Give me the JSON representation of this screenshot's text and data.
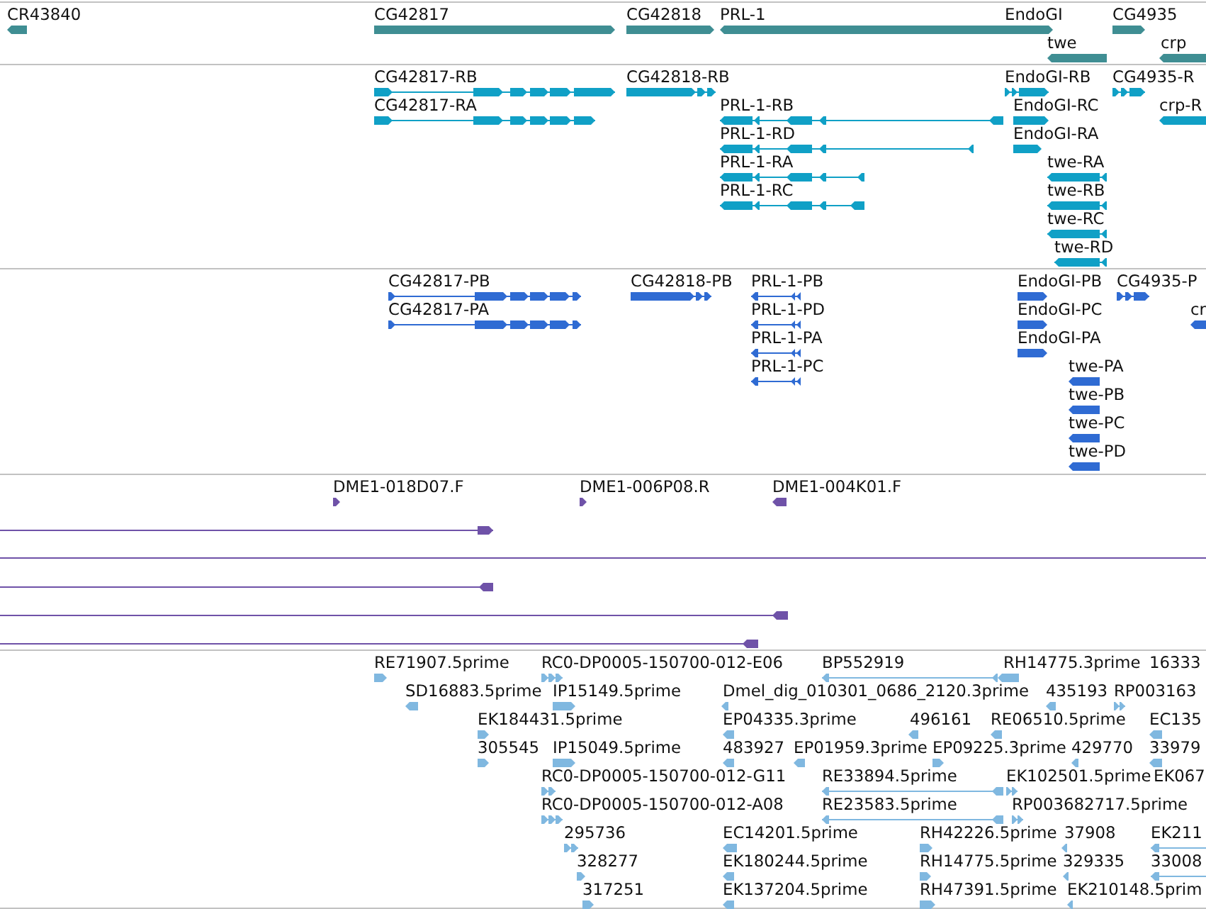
{
  "tracks": [
    {
      "kind": "gene",
      "features": [
        {
          "label": "CR43840",
          "forward": false
        },
        {
          "label": "CG42817",
          "forward": true
        },
        {
          "label": "CG42818",
          "forward": true
        },
        {
          "label": "PRL-1",
          "forward": false
        },
        {
          "label": "EndoGI",
          "forward": true
        },
        {
          "label": "twe",
          "forward": false
        },
        {
          "label": "CG4935",
          "forward": true
        },
        {
          "label": "crp",
          "forward": false
        }
      ]
    },
    {
      "kind": "transcript",
      "features": [
        {
          "label": "CG42817-RB",
          "forward": true
        },
        {
          "label": "CG42817-RA",
          "forward": true
        },
        {
          "label": "CG42818-RB",
          "forward": true
        },
        {
          "label": "PRL-1-RB",
          "forward": false
        },
        {
          "label": "PRL-1-RD",
          "forward": false
        },
        {
          "label": "PRL-1-RA",
          "forward": false
        },
        {
          "label": "PRL-1-RC",
          "forward": false
        },
        {
          "label": "EndoGI-RB",
          "forward": true
        },
        {
          "label": "EndoGI-RC",
          "forward": true
        },
        {
          "label": "EndoGI-RA",
          "forward": true
        },
        {
          "label": "twe-RA",
          "forward": false
        },
        {
          "label": "twe-RB",
          "forward": false
        },
        {
          "label": "twe-RC",
          "forward": false
        },
        {
          "label": "twe-RD",
          "forward": false
        },
        {
          "label": "CG4935-R",
          "forward": true
        },
        {
          "label": "crp-R",
          "forward": false
        }
      ]
    },
    {
      "kind": "protein",
      "features": [
        {
          "label": "CG42817-PB",
          "forward": true
        },
        {
          "label": "CG42817-PA",
          "forward": true
        },
        {
          "label": "CG42818-PB",
          "forward": true
        },
        {
          "label": "PRL-1-PB",
          "forward": false
        },
        {
          "label": "PRL-1-PD",
          "forward": false
        },
        {
          "label": "PRL-1-PA",
          "forward": false
        },
        {
          "label": "PRL-1-PC",
          "forward": false
        },
        {
          "label": "EndoGI-PB",
          "forward": true
        },
        {
          "label": "EndoGI-PC",
          "forward": true
        },
        {
          "label": "EndoGI-PA",
          "forward": true
        },
        {
          "label": "twe-PA",
          "forward": false
        },
        {
          "label": "twe-PB",
          "forward": false
        },
        {
          "label": "twe-PC",
          "forward": false
        },
        {
          "label": "twe-PD",
          "forward": false
        },
        {
          "label": "CG4935-P",
          "forward": true
        },
        {
          "label": "cr",
          "forward": false
        }
      ]
    },
    {
      "kind": "clone",
      "features": [
        {
          "label": "DME1-018D07.F",
          "forward": true
        },
        {
          "label": "DME1-006P08.R",
          "forward": true
        },
        {
          "label": "DME1-004K01.F",
          "forward": false
        },
        {
          "forward": true
        },
        {
          "forward": false
        },
        {
          "forward": false
        },
        {
          "forward": false
        }
      ]
    },
    {
      "kind": "est",
      "features": [
        {
          "label": "RE71907.5prime",
          "forward": true
        },
        {
          "label": "RC0-DP0005-150700-012-E06",
          "forward": true
        },
        {
          "label": "BP552919",
          "forward": false
        },
        {
          "label": "RH14775.3prime",
          "forward": false
        },
        {
          "label": "16333"
        },
        {
          "label": "SD16883.5prime",
          "forward": false
        },
        {
          "label": "IP15149.5prime",
          "forward": true
        },
        {
          "label": "Dmel_dig_010301_0686_2120.3prime",
          "forward": false
        },
        {
          "label": "435193",
          "forward": false
        },
        {
          "label": "RP003163",
          "forward": true
        },
        {
          "label": "EK184431.5prime",
          "forward": true
        },
        {
          "label": "EP04335.3prime",
          "forward": false
        },
        {
          "label": "496161",
          "forward": false
        },
        {
          "label": "RE06510.5prime",
          "forward": false
        },
        {
          "label": "EC135",
          "forward": false
        },
        {
          "label": "305545",
          "forward": true
        },
        {
          "label": "IP15049.5prime",
          "forward": true
        },
        {
          "label": "483927",
          "forward": false
        },
        {
          "label": "EP01959.3prime",
          "forward": false
        },
        {
          "label": "EP09225.3prime",
          "forward": true
        },
        {
          "label": "429770",
          "forward": false
        },
        {
          "label": "33979",
          "forward": false
        },
        {
          "label": "RC0-DP0005-150700-012-G11",
          "forward": true
        },
        {
          "label": "RE33894.5prime",
          "forward": false
        },
        {
          "label": "EK102501.5prime",
          "forward": true
        },
        {
          "label": "EK067"
        },
        {
          "label": "RC0-DP0005-150700-012-A08",
          "forward": true
        },
        {
          "label": "RE23583.5prime",
          "forward": false
        },
        {
          "label": "RP003682717.5prime",
          "forward": true
        },
        {
          "label": "295736",
          "forward": true
        },
        {
          "label": "EC14201.5prime",
          "forward": false
        },
        {
          "label": "RH42226.5prime",
          "forward": true
        },
        {
          "label": "37908",
          "forward": false
        },
        {
          "label": "EK211",
          "forward": false
        },
        {
          "label": "328277",
          "forward": true
        },
        {
          "label": "EK180244.5prime",
          "forward": false
        },
        {
          "label": "RH14775.5prime",
          "forward": true
        },
        {
          "label": "329335",
          "forward": false
        },
        {
          "label": "33008",
          "forward": false
        },
        {
          "label": "317251",
          "forward": true
        },
        {
          "label": "EK137204.5prime",
          "forward": false
        },
        {
          "label": "RH47391.5prime",
          "forward": true
        },
        {
          "label": "EK210148.5prim",
          "forward": false
        }
      ]
    }
  ]
}
